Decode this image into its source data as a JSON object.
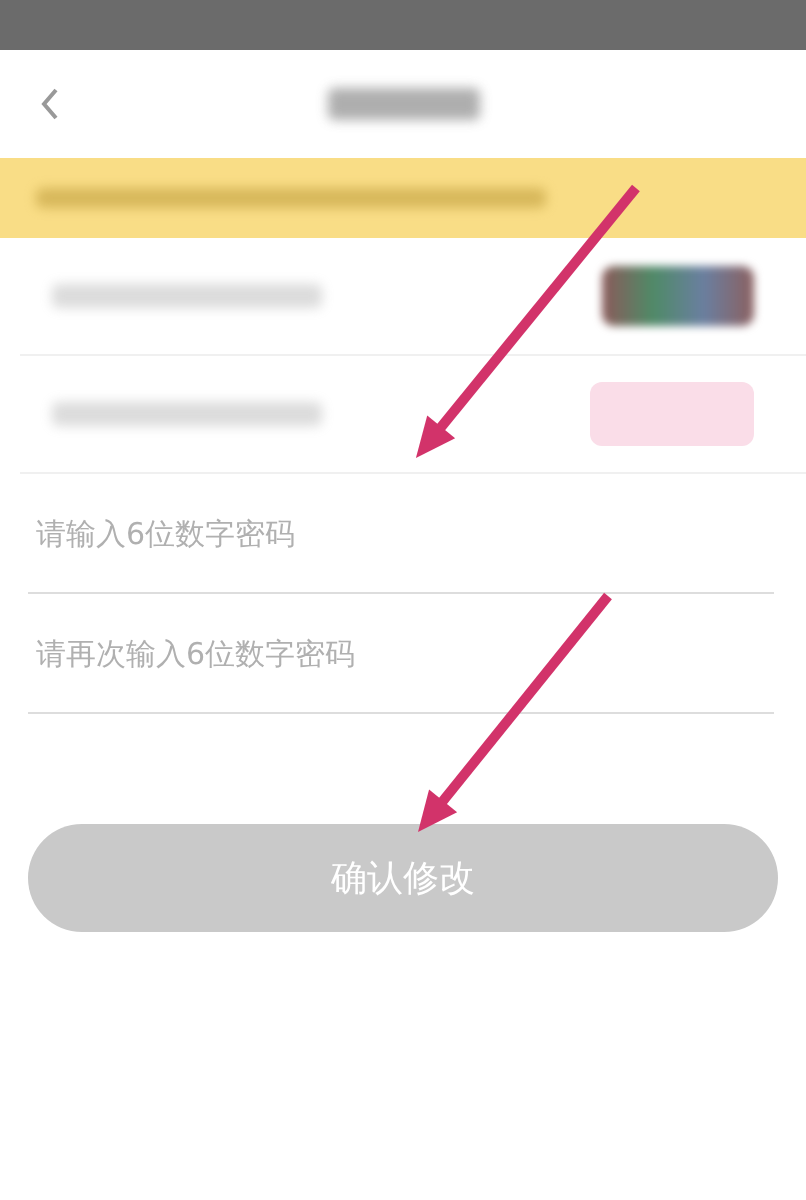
{
  "verify_rows": [
    {
      "kind": "image_code"
    },
    {
      "kind": "sms_code"
    }
  ],
  "fields": [
    {
      "placeholder": "请输入6位数字密码",
      "arrow": true
    },
    {
      "placeholder": "请再次输入6位数字密码",
      "arrow": false
    }
  ],
  "button": {
    "label": "确认修改",
    "disabled": true,
    "arrow": true
  }
}
